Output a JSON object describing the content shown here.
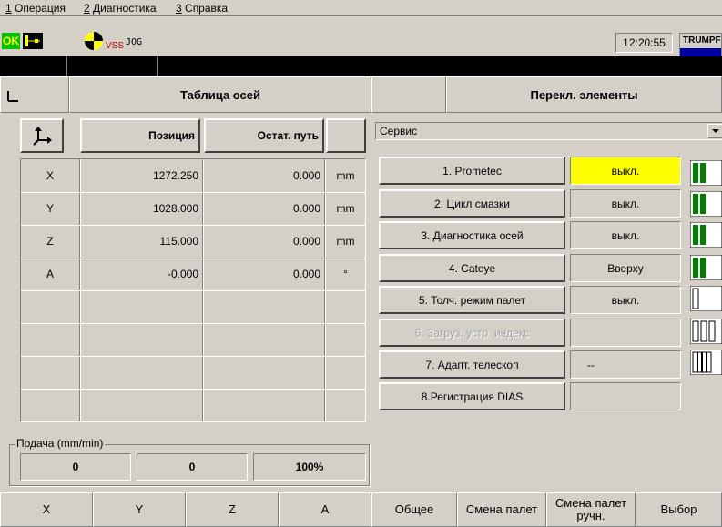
{
  "menu": [
    {
      "num": "1",
      "label": " Операция"
    },
    {
      "num": "2",
      "label": " Диагностика"
    },
    {
      "num": "3",
      "label": " Справка"
    }
  ],
  "status": {
    "mode_ok": "OK",
    "vss": "VSS",
    "jog": "JOG",
    "time": "12:20:55",
    "brand": "TRUMPF"
  },
  "axes_panel": {
    "title": "Таблица осей",
    "col_position": "Позиция",
    "col_remaining": "Остат. путь",
    "rows": [
      {
        "axis": "X",
        "position": "1272.250",
        "remaining": "0.000",
        "unit": "mm"
      },
      {
        "axis": "Y",
        "position": "1028.000",
        "remaining": "0.000",
        "unit": "mm"
      },
      {
        "axis": "Z",
        "position": "115.000",
        "remaining": "0.000",
        "unit": "mm"
      },
      {
        "axis": "A",
        "position": "-0.000",
        "remaining": "0.000",
        "unit": "°"
      }
    ]
  },
  "feed": {
    "label": "Подача (mm/min)",
    "val1": "0",
    "val2": "0",
    "override": "100%"
  },
  "switch_panel": {
    "title": "Перекл. элементы",
    "dropdown": "Сервис",
    "items": [
      {
        "label": "1. Prometec",
        "state": "выкл.",
        "highlight": true,
        "enabled": true
      },
      {
        "label": "2. Цикл смазки",
        "state": "выкл.",
        "highlight": false,
        "enabled": true
      },
      {
        "label": "3. Диагностика осей",
        "state": "выкл.",
        "highlight": false,
        "enabled": true
      },
      {
        "label": "4. Cateye",
        "state": "Вверху",
        "highlight": false,
        "enabled": true
      },
      {
        "label": "5. Толч. режим палет",
        "state": "выкл.",
        "highlight": false,
        "enabled": true
      },
      {
        "label": "6. Загруз. устр. индекс",
        "state": "",
        "highlight": false,
        "enabled": false
      },
      {
        "label": "7. Адапт. телескоп",
        "state": "--",
        "highlight": false,
        "enabled": true
      },
      {
        "label": "8.Регистрация DIAS",
        "state": "",
        "highlight": false,
        "enabled": true
      }
    ]
  },
  "softkeys": {
    "k1": "X",
    "k2": "Y",
    "k3": "Z",
    "k4": "A",
    "k5": "Общее",
    "k6": "Смена палет",
    "k7": "Смена палет ручн.",
    "k8": "Выбор"
  },
  "colors": {
    "ok_green": "#00c000",
    "highlight_yellow": "#ffff00",
    "brand_blue": "#0000a0",
    "indicator_green": "#008000"
  }
}
